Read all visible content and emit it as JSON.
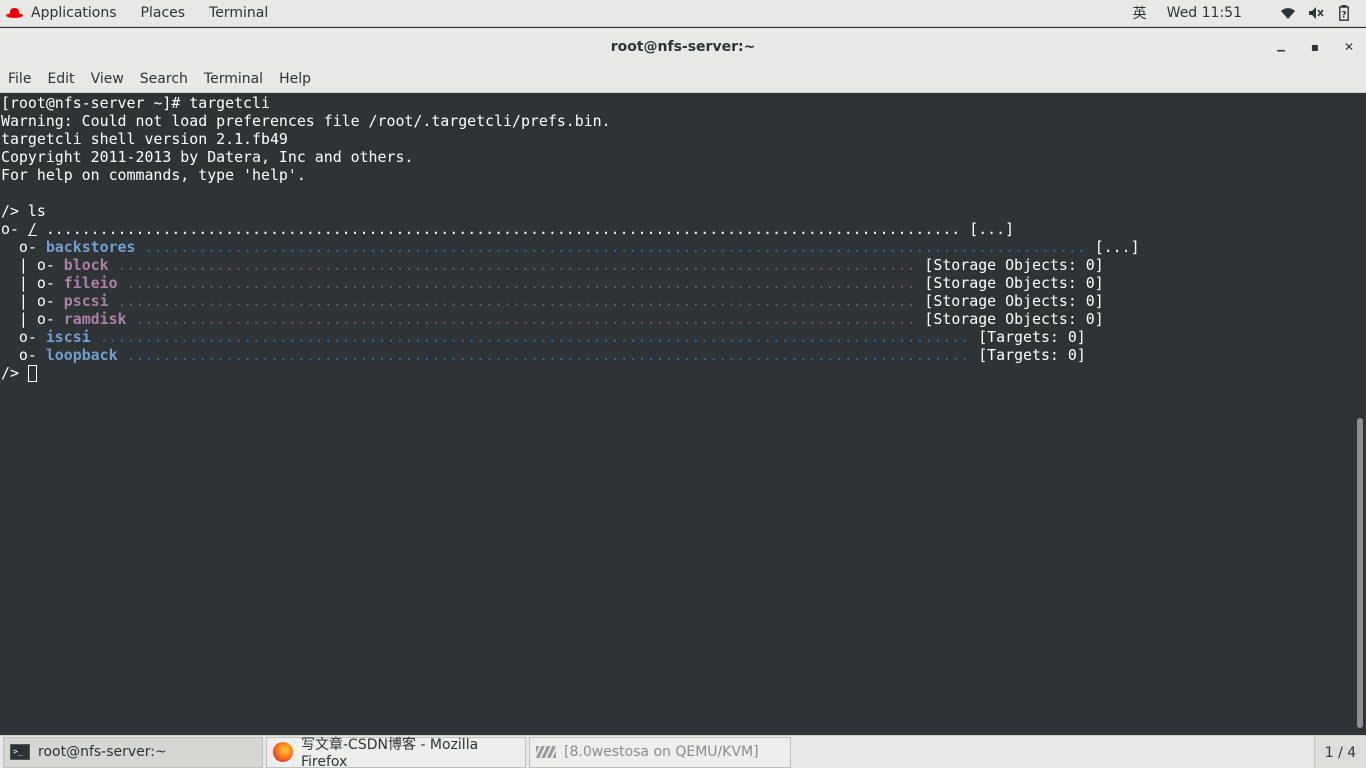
{
  "topbar": {
    "applications": "Applications",
    "places": "Places",
    "terminal": "Terminal",
    "ime": "英",
    "clock": "Wed 11:51",
    "icons": [
      "wifi-icon",
      "volume-muted-icon",
      "battery-unknown-icon"
    ]
  },
  "window": {
    "title": "root@nfs-server:~",
    "controls": {
      "minimize": "▁",
      "maximize": "▪",
      "close": "✕"
    }
  },
  "menubar": [
    "File",
    "Edit",
    "View",
    "Search",
    "Terminal",
    "Help"
  ],
  "terminal": {
    "lines": [
      "[root@nfs-server ~]# targetcli",
      "Warning: Could not load preferences file /root/.targetcli/prefs.bin.",
      "targetcli shell version 2.1.fb49",
      "Copyright 2011-2013 by Datera, Inc and others.",
      "For help on commands, type 'help'.",
      "",
      "/> ls"
    ],
    "tree": {
      "root": {
        "prefix": "o- ",
        "name": "/",
        "dots": " ...................................................................................................... ",
        "status": "[...]"
      },
      "backstores": {
        "prefix": "  o- ",
        "name": "backstores",
        "dots": " ......................................................................................................... ",
        "status": "[...]"
      },
      "block": {
        "prefix": "  | o- ",
        "name": "block",
        "dots": " ......................................................................................... ",
        "status": "[Storage Objects: 0]"
      },
      "fileio": {
        "prefix": "  | o- ",
        "name": "fileio",
        "dots": " ........................................................................................ ",
        "status": "[Storage Objects: 0]"
      },
      "pscsi": {
        "prefix": "  | o- ",
        "name": "pscsi",
        "dots": " ......................................................................................... ",
        "status": "[Storage Objects: 0]"
      },
      "ramdisk": {
        "prefix": "  | o- ",
        "name": "ramdisk",
        "dots": " ....................................................................................... ",
        "status": "[Storage Objects: 0]"
      },
      "iscsi": {
        "prefix": "  o- ",
        "name": "iscsi",
        "dots": " ................................................................................................. ",
        "status": "[Targets: 0]"
      },
      "loopback": {
        "prefix": "  o- ",
        "name": "loopback",
        "dots": " .............................................................................................. ",
        "status": "[Targets: 0]"
      }
    },
    "prompt": "/> "
  },
  "taskbar": {
    "tasks": [
      {
        "label": "root@nfs-server:~",
        "icon": "terminal-icon"
      },
      {
        "label": "写文章-CSDN博客 - Mozilla Firefox",
        "icon": "firefox-icon"
      },
      {
        "label": "[8.0westosa on QEMU/KVM]",
        "icon": "virt-manager-icon"
      }
    ],
    "workspace": "1 / 4"
  }
}
